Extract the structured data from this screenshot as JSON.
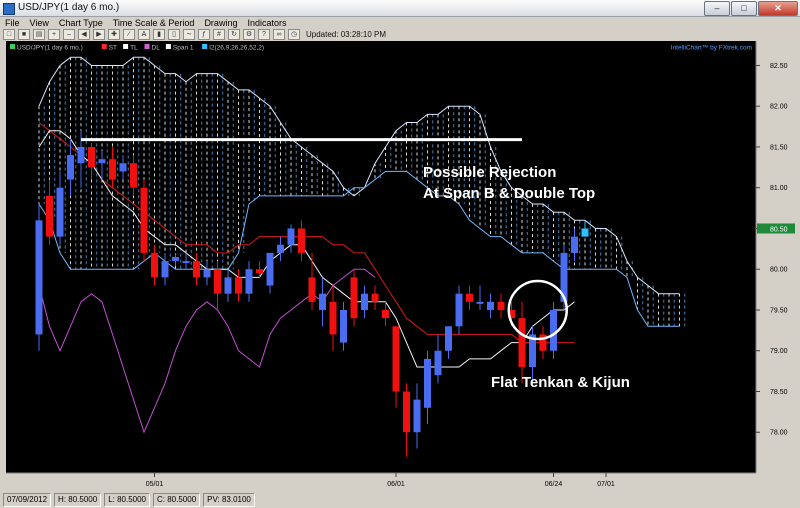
{
  "window": {
    "title": "USD/JPY(1 day  6 mo.)"
  },
  "menu": [
    "File",
    "View",
    "Chart Type",
    "Time Scale & Period",
    "Drawing",
    "Indicators"
  ],
  "toolbar": {
    "updated": "Updated: 03:28:10 PM"
  },
  "legend": {
    "items": [
      {
        "label": "USD/JPY(1 day  6 mo.)",
        "color": "#34d058"
      },
      {
        "label": "ST",
        "color": "#ff2a2a"
      },
      {
        "label": "TL",
        "color": "#ffffff"
      },
      {
        "label": "DL",
        "color": "#d060d0"
      },
      {
        "label": "Span 1",
        "color": "#ffffff"
      },
      {
        "label": "I2(26,9,26,26,52,2)",
        "color": "#2ec0ff"
      }
    ],
    "brand": "IntelliChart™ by FXtrek.com"
  },
  "chart_data": {
    "type": "candlestick",
    "symbol": "USD/JPY",
    "ylim": [
      77.5,
      82.8
    ],
    "yticks": [
      "82.50",
      "82.00",
      "81.50",
      "81.00",
      "80.50",
      "80.00",
      "79.50",
      "79.00",
      "78.50",
      "78.00"
    ],
    "last_price": "80.50",
    "xticks": [
      {
        "label": "05/01",
        "index": 11
      },
      {
        "label": "06/01",
        "index": 34
      },
      {
        "label": "06/24",
        "index": 49
      },
      {
        "label": "07/01",
        "index": 54
      }
    ],
    "candles": [
      {
        "o": 79.2,
        "h": 80.8,
        "l": 79.0,
        "c": 80.6
      },
      {
        "o": 80.9,
        "h": 81.1,
        "l": 80.3,
        "c": 80.4
      },
      {
        "o": 80.4,
        "h": 81.2,
        "l": 80.3,
        "c": 81.0
      },
      {
        "o": 81.1,
        "h": 81.6,
        "l": 80.9,
        "c": 81.4
      },
      {
        "o": 81.3,
        "h": 81.7,
        "l": 81.0,
        "c": 81.5
      },
      {
        "o": 81.5,
        "h": 81.55,
        "l": 81.1,
        "c": 81.25
      },
      {
        "o": 81.3,
        "h": 81.45,
        "l": 81.1,
        "c": 81.35
      },
      {
        "o": 81.35,
        "h": 81.5,
        "l": 81.0,
        "c": 81.1
      },
      {
        "o": 81.2,
        "h": 81.4,
        "l": 81.1,
        "c": 81.3
      },
      {
        "o": 81.3,
        "h": 81.4,
        "l": 80.9,
        "c": 81.0
      },
      {
        "o": 81.0,
        "h": 81.1,
        "l": 80.1,
        "c": 80.2
      },
      {
        "o": 80.2,
        "h": 80.3,
        "l": 79.8,
        "c": 79.9
      },
      {
        "o": 79.9,
        "h": 80.2,
        "l": 79.8,
        "c": 80.1
      },
      {
        "o": 80.1,
        "h": 80.2,
        "l": 80.05,
        "c": 80.15
      },
      {
        "o": 80.1,
        "h": 80.2,
        "l": 80.0,
        "c": 80.1
      },
      {
        "o": 80.1,
        "h": 80.2,
        "l": 79.8,
        "c": 79.9
      },
      {
        "o": 79.9,
        "h": 80.1,
        "l": 79.8,
        "c": 80.0
      },
      {
        "o": 80.0,
        "h": 80.1,
        "l": 79.5,
        "c": 79.7
      },
      {
        "o": 79.7,
        "h": 80.0,
        "l": 79.6,
        "c": 79.9
      },
      {
        "o": 79.9,
        "h": 80.0,
        "l": 79.6,
        "c": 79.7
      },
      {
        "o": 79.7,
        "h": 80.1,
        "l": 79.6,
        "c": 80.0
      },
      {
        "o": 80.0,
        "h": 80.1,
        "l": 79.9,
        "c": 79.95
      },
      {
        "o": 79.8,
        "h": 80.2,
        "l": 79.7,
        "c": 80.2
      },
      {
        "o": 80.2,
        "h": 80.4,
        "l": 80.1,
        "c": 80.3
      },
      {
        "o": 80.3,
        "h": 80.55,
        "l": 80.2,
        "c": 80.5
      },
      {
        "o": 80.5,
        "h": 80.6,
        "l": 80.1,
        "c": 80.2
      },
      {
        "o": 79.9,
        "h": 80.2,
        "l": 79.5,
        "c": 79.6
      },
      {
        "o": 79.5,
        "h": 79.9,
        "l": 79.3,
        "c": 79.7
      },
      {
        "o": 79.6,
        "h": 79.8,
        "l": 79.0,
        "c": 79.2
      },
      {
        "o": 79.1,
        "h": 79.6,
        "l": 79.0,
        "c": 79.5
      },
      {
        "o": 79.9,
        "h": 80.0,
        "l": 79.3,
        "c": 79.4
      },
      {
        "o": 79.5,
        "h": 79.8,
        "l": 79.4,
        "c": 79.7
      },
      {
        "o": 79.7,
        "h": 79.8,
        "l": 79.5,
        "c": 79.6
      },
      {
        "o": 79.5,
        "h": 79.6,
        "l": 79.3,
        "c": 79.4
      },
      {
        "o": 79.3,
        "h": 79.3,
        "l": 78.3,
        "c": 78.5
      },
      {
        "o": 78.5,
        "h": 78.6,
        "l": 77.7,
        "c": 78.0
      },
      {
        "o": 78.0,
        "h": 78.6,
        "l": 77.8,
        "c": 78.4
      },
      {
        "o": 78.3,
        "h": 79.0,
        "l": 78.1,
        "c": 78.9
      },
      {
        "o": 78.7,
        "h": 79.2,
        "l": 78.6,
        "c": 79.0
      },
      {
        "o": 79.0,
        "h": 79.3,
        "l": 78.9,
        "c": 79.3
      },
      {
        "o": 79.3,
        "h": 79.8,
        "l": 79.2,
        "c": 79.7
      },
      {
        "o": 79.7,
        "h": 79.8,
        "l": 79.5,
        "c": 79.6
      },
      {
        "o": 79.6,
        "h": 79.8,
        "l": 79.5,
        "c": 79.6
      },
      {
        "o": 79.5,
        "h": 79.7,
        "l": 79.4,
        "c": 79.6
      },
      {
        "o": 79.6,
        "h": 79.7,
        "l": 79.4,
        "c": 79.5
      },
      {
        "o": 79.5,
        "h": 79.6,
        "l": 79.3,
        "c": 79.4
      },
      {
        "o": 79.4,
        "h": 79.6,
        "l": 78.6,
        "c": 78.8
      },
      {
        "o": 78.8,
        "h": 79.3,
        "l": 78.6,
        "c": 79.2
      },
      {
        "o": 79.2,
        "h": 79.3,
        "l": 78.9,
        "c": 79.0
      },
      {
        "o": 79.0,
        "h": 79.6,
        "l": 78.9,
        "c": 79.5
      },
      {
        "o": 79.6,
        "h": 80.3,
        "l": 79.5,
        "c": 80.2
      },
      {
        "o": 80.2,
        "h": 80.5,
        "l": 80.1,
        "c": 80.4
      },
      {
        "o": 80.4,
        "h": 80.6,
        "l": 80.4,
        "c": 80.5
      }
    ],
    "tenkan": [
      81.5,
      81.7,
      81.7,
      81.6,
      81.4,
      81.3,
      81.1,
      80.9,
      80.8,
      80.7,
      80.5,
      80.4,
      80.3,
      80.3,
      80.2,
      80.1,
      80.0,
      80.0,
      80.0,
      79.9,
      79.9,
      79.9,
      80.1,
      80.2,
      80.3,
      80.3,
      80.1,
      79.9,
      79.8,
      79.7,
      79.6,
      79.6,
      79.6,
      79.6,
      79.4,
      79.1,
      78.8,
      78.8,
      78.8,
      78.8,
      78.8,
      78.9,
      78.9,
      78.9,
      79.0,
      79.1,
      79.1,
      79.3,
      79.4,
      79.5,
      79.5,
      79.6
    ],
    "kijun": [
      81.8,
      81.7,
      81.6,
      81.5,
      81.4,
      81.3,
      81.1,
      81.0,
      80.9,
      80.8,
      80.7,
      80.6,
      80.5,
      80.4,
      80.3,
      80.3,
      80.3,
      80.2,
      80.2,
      80.3,
      80.3,
      80.4,
      80.4,
      80.4,
      80.4,
      80.4,
      80.4,
      80.4,
      80.3,
      80.3,
      80.2,
      80.2,
      80.0,
      79.8,
      79.6,
      79.4,
      79.3,
      79.2,
      79.2,
      79.2,
      79.2,
      79.2,
      79.2,
      79.2,
      79.2,
      79.2,
      79.1,
      79.1,
      79.1,
      79.1,
      79.1,
      79.1
    ],
    "chikou": [
      79.8,
      79.3,
      79.0,
      79.3,
      79.6,
      79.7,
      79.6,
      79.2,
      78.8,
      78.4,
      78.0,
      78.3,
      78.6,
      79.0,
      79.3,
      79.5,
      79.6,
      79.5,
      79.3,
      79.0,
      78.9,
      78.8,
      79.2,
      79.4,
      79.5,
      79.6,
      79.7,
      79.6,
      79.8,
      79.9,
      80.0,
      80.0,
      79.9
    ],
    "span_a": [
      82.0,
      82.3,
      82.5,
      82.6,
      82.6,
      82.5,
      82.5,
      82.5,
      82.5,
      82.6,
      82.6,
      82.5,
      82.4,
      82.4,
      82.3,
      82.4,
      82.4,
      82.4,
      82.3,
      82.2,
      82.2,
      82.1,
      82.0,
      81.8,
      81.6,
      81.5,
      81.4,
      81.3,
      81.2,
      81.0,
      80.9,
      81.0,
      81.3,
      81.5,
      81.7,
      81.8,
      81.8,
      81.9,
      81.9,
      82.0,
      82.0,
      82.0,
      81.9,
      81.5,
      81.2,
      81.0,
      80.9,
      80.8,
      80.8,
      80.7,
      80.7,
      80.6,
      80.6,
      80.5,
      80.5,
      80.4,
      80.1,
      79.9,
      79.8,
      79.7,
      79.7,
      79.7
    ],
    "span_b": [
      80.8,
      80.6,
      80.2,
      80.0,
      80.0,
      80.0,
      80.0,
      80.0,
      80.0,
      80.0,
      80.1,
      80.2,
      80.1,
      80.0,
      80.0,
      80.0,
      80.0,
      80.0,
      80.0,
      80.2,
      80.8,
      80.9,
      80.9,
      80.9,
      80.9,
      80.9,
      80.9,
      80.9,
      80.9,
      80.9,
      81.0,
      81.0,
      81.1,
      81.2,
      81.2,
      81.2,
      81.1,
      81.0,
      80.9,
      80.9,
      80.8,
      80.6,
      80.5,
      80.4,
      80.4,
      80.3,
      80.2,
      80.2,
      80.2,
      80.1,
      80.0,
      80.0,
      80.0,
      80.0,
      80.0,
      80.0,
      79.9,
      79.5,
      79.3,
      79.3,
      79.3,
      79.3
    ],
    "annotations": {
      "rejection_line": {
        "value": 81.59,
        "from_index": 4,
        "to_index": 46
      },
      "text1": "Possible Rejection",
      "text2": "At Span B & Double Top",
      "text3": "Flat Tenkan & Kijun",
      "circle_center": {
        "index": 47.5,
        "value": 79.5
      }
    }
  },
  "status": {
    "date": "07/09/2012",
    "high": "H: 80.5000",
    "low": "L: 80.5000",
    "close": "C: 80.5000",
    "pv": "PV: 83.0100"
  }
}
